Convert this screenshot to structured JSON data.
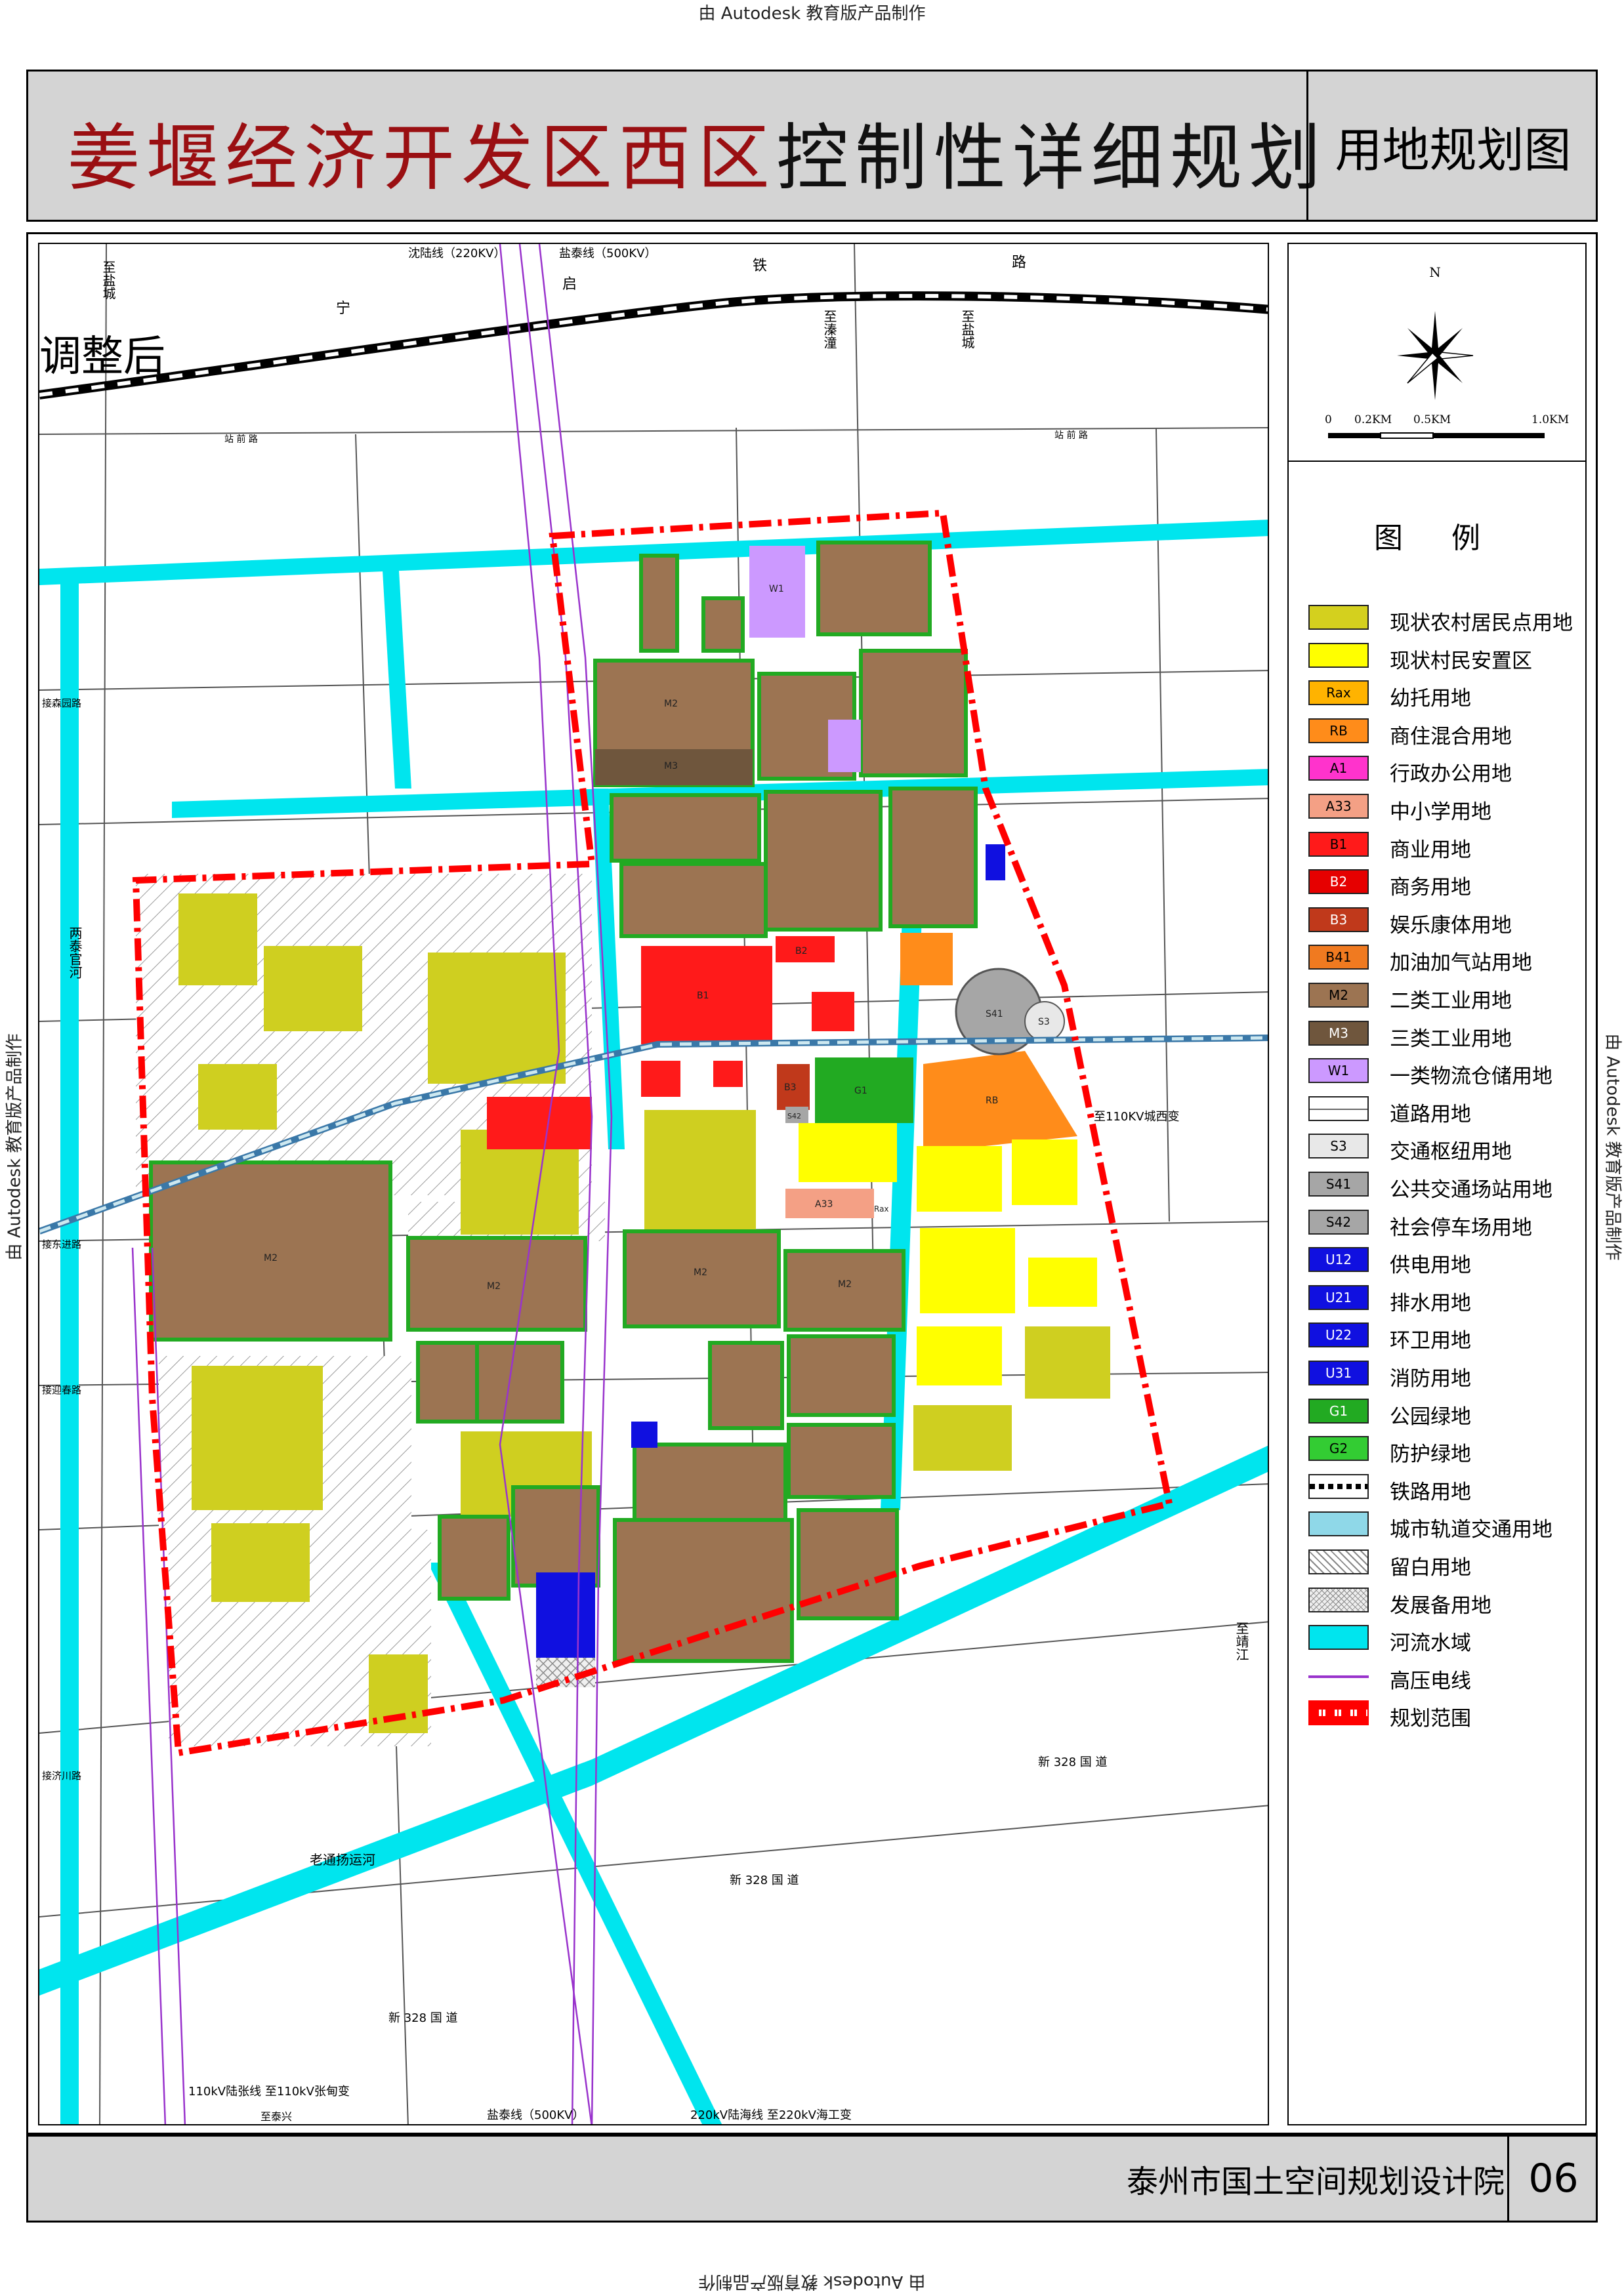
{
  "watermark": "由 Autodesk 教育版产品制作",
  "title": {
    "part1": "姜堰经济开发区西区",
    "part2": "控制性详细规划",
    "subtitle": "用地规划图"
  },
  "map": {
    "status_label": "调整后",
    "compass_north": "N",
    "scale": {
      "labels": [
        "0",
        "0.2KM",
        "0.5KM",
        "1.0KM"
      ]
    },
    "annotations": {
      "line_shenlu": "沈陆线（220KV）",
      "line_yantai_top": "盐泰线（500KV）",
      "rail_chars": [
        "宁",
        "启",
        "铁",
        "路"
      ],
      "to_yancheng_left": "至盐城",
      "to_qintong": "至溱潼",
      "to_yancheng_right": "至盐城",
      "to_jingjiang": "至靖江",
      "road_zhanqian_left": "站 前 路",
      "road_zhanqian_right": "站 前 路",
      "road_jiesen": "接森园路",
      "road_jiedong": "接东进路",
      "road_jieying": "接迎春路",
      "road_jieji": "接济川路",
      "road_new328a": "新 328 国 道",
      "road_new328b": "新 328 国 道",
      "road_new328c": "新 328 国 道",
      "to_chengxi_sub": "至110KV城西变",
      "line_110_bottom": "110kV陆张线  至110kV张甸变",
      "to_taixing": "至泰兴",
      "line_yantai_bottom": "盐泰线（500KV）",
      "line_220_bottom": "220kV陆海线  至220kV海工变",
      "river_liangtai": "两泰官河",
      "river_laotong": "老通扬运河"
    },
    "parcel_codes": {
      "M2": "M2",
      "M3": "M3",
      "W1": "W1",
      "B1": "B1",
      "B2": "B2",
      "B3": "B3",
      "RB": "RB",
      "A33": "A33",
      "G1": "G1",
      "S41": "S41",
      "S3": "S3",
      "S42": "S42",
      "Rax": "Rax"
    }
  },
  "legend": {
    "title": "图 例",
    "items": [
      {
        "code": "",
        "label": "现状农村居民点用地",
        "color": "#d4d01e"
      },
      {
        "code": "",
        "label": "现状村民安置区",
        "color": "#ffff00"
      },
      {
        "code": "Rax",
        "label": "幼托用地",
        "color": "#ffb300"
      },
      {
        "code": "RB",
        "label": "商住混合用地",
        "color": "#ff8c1a"
      },
      {
        "code": "A1",
        "label": "行政办公用地",
        "color": "#ff33cc"
      },
      {
        "code": "A33",
        "label": "中小学用地",
        "color": "#f4a085"
      },
      {
        "code": "B1",
        "label": "商业用地",
        "color": "#ff1a1a"
      },
      {
        "code": "B2",
        "label": "商务用地",
        "color": "#e60000"
      },
      {
        "code": "B3",
        "label": "娱乐康体用地",
        "color": "#c0391b"
      },
      {
        "code": "B41",
        "label": "加油加气站用地",
        "color": "#f07a20"
      },
      {
        "code": "M2",
        "label": "二类工业用地",
        "color": "#9c7452"
      },
      {
        "code": "M3",
        "label": "三类工业用地",
        "color": "#6f563d"
      },
      {
        "code": "W1",
        "label": "一类物流仓储用地",
        "color": "#cc99ff"
      },
      {
        "code": "",
        "label": "道路用地",
        "color": "#ffffff"
      },
      {
        "code": "S3",
        "label": "交通枢纽用地",
        "color": "#e8e8e8"
      },
      {
        "code": "S41",
        "label": "公共交通场站用地",
        "color": "#a6a6a6"
      },
      {
        "code": "S42",
        "label": "社会停车场用地",
        "color": "#a6a6a6"
      },
      {
        "code": "U12",
        "label": "供电用地",
        "color": "#1010e0"
      },
      {
        "code": "U21",
        "label": "排水用地",
        "color": "#1010e0"
      },
      {
        "code": "U22",
        "label": "环卫用地",
        "color": "#1010e0"
      },
      {
        "code": "U31",
        "label": "消防用地",
        "color": "#1010e0"
      },
      {
        "code": "G1",
        "label": "公园绿地",
        "color": "#22aa22"
      },
      {
        "code": "G2",
        "label": "防护绿地",
        "color": "#33cc33"
      },
      {
        "code": "",
        "label": "铁路用地",
        "color": "#ffffff"
      },
      {
        "code": "",
        "label": "城市轨道交通用地",
        "color": "#8fd8e8"
      },
      {
        "code": "",
        "label": "留白用地",
        "color": "#ffffff"
      },
      {
        "code": "",
        "label": "发展备用地",
        "color": "#eeeeee"
      },
      {
        "code": "",
        "label": "河流水域",
        "color": "#00e5ee"
      },
      {
        "code": "",
        "label": "高压电线",
        "color": "#9933cc"
      },
      {
        "code": "",
        "label": "规划范围",
        "color": "#ff0000"
      }
    ]
  },
  "footer": {
    "org": "泰州市国土空间规划设计院",
    "sheet_no": "06"
  }
}
